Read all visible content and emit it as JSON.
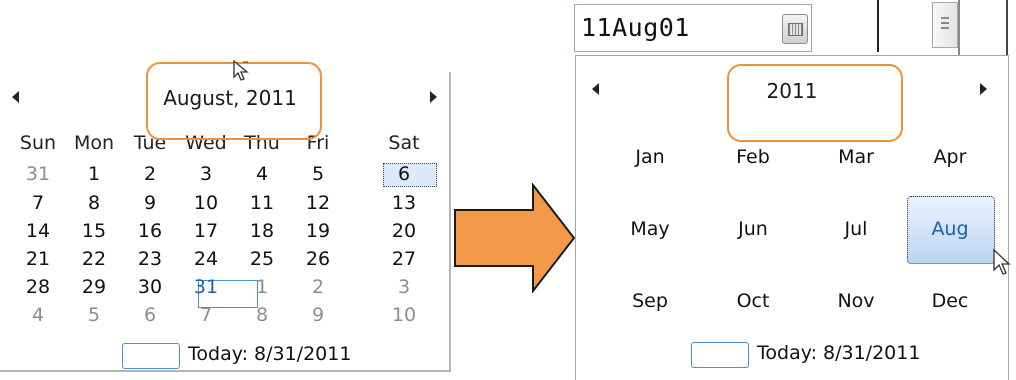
{
  "left_calendar": {
    "title": "August, 2011",
    "weekdays": [
      "Sun",
      "Mon",
      "Tue",
      "Wed",
      "Thu",
      "Fri",
      "Sat"
    ],
    "weeks": [
      [
        "31",
        "1",
        "2",
        "3",
        "4",
        "5",
        "6"
      ],
      [
        "7",
        "8",
        "9",
        "10",
        "11",
        "12",
        "13"
      ],
      [
        "14",
        "15",
        "16",
        "17",
        "18",
        "19",
        "20"
      ],
      [
        "21",
        "22",
        "23",
        "24",
        "25",
        "26",
        "27"
      ],
      [
        "28",
        "29",
        "30",
        "31",
        "1",
        "2",
        "3"
      ],
      [
        "4",
        "5",
        "6",
        "7",
        "8",
        "9",
        "10"
      ]
    ],
    "today_label": "Today: 8/31/2011",
    "selected_day": "6"
  },
  "right_calendar": {
    "date_value": "11Aug01",
    "year_title": "2011",
    "months": [
      [
        "Jan",
        "Feb",
        "Mar",
        "Apr"
      ],
      [
        "May",
        "Jun",
        "Jul",
        "Aug"
      ],
      [
        "Sep",
        "Oct",
        "Nov",
        "Dec"
      ]
    ],
    "selected_month": "Aug",
    "today_label": "Today: 8/31/2011"
  },
  "colors": {
    "highlight_outline": "#f0913a",
    "arrow_fill": "#f39a4a",
    "accent_blue": "#4a8fd6"
  },
  "icons": {
    "prev": "triangle-left-icon",
    "next": "triangle-right-icon",
    "dropdown": "calendar-dropdown-icon",
    "cursor": "mouse-pointer-icon"
  }
}
